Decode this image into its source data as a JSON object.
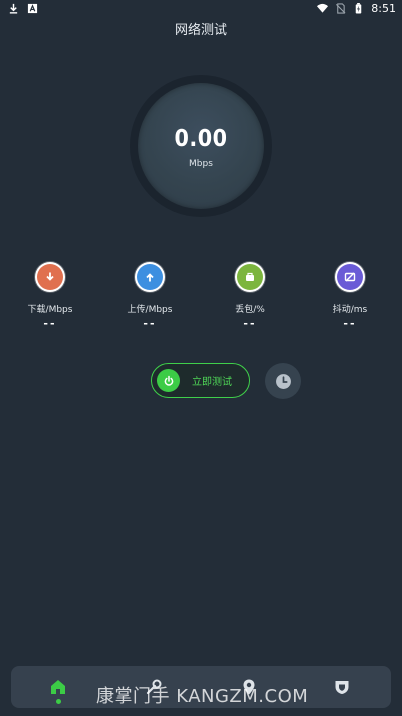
{
  "status_bar": {
    "time": "8:51",
    "left_icons": [
      "download-icon",
      "app-notification-icon"
    ],
    "right_icons": [
      "wifi-icon",
      "no-sim-icon",
      "battery-icon"
    ]
  },
  "header": {
    "title": "网络测试"
  },
  "gauge": {
    "value": "0.00",
    "unit": "Mbps"
  },
  "stats": [
    {
      "label": "下载/Mbps",
      "value": "--",
      "icon": "download-arrow-icon",
      "color": "#e0704f"
    },
    {
      "label": "上传/Mbps",
      "value": "--",
      "icon": "upload-arrow-icon",
      "color": "#3d8fe0"
    },
    {
      "label": "丢包/%",
      "value": "--",
      "icon": "packet-loss-icon",
      "color": "#7cb53e"
    },
    {
      "label": "抖动/ms",
      "value": "--",
      "icon": "jitter-icon",
      "color": "#6a5bd6"
    }
  ],
  "actions": {
    "start_label": "立即测试",
    "start_icon": "power-icon",
    "history_icon": "clock-icon"
  },
  "bottom_nav": {
    "items": [
      "home-icon",
      "tools-icon",
      "location-icon",
      "shield-icon"
    ],
    "active_index": 0,
    "active_color": "#3ccc46"
  },
  "watermark": "康掌门手 KANGZM.COM"
}
